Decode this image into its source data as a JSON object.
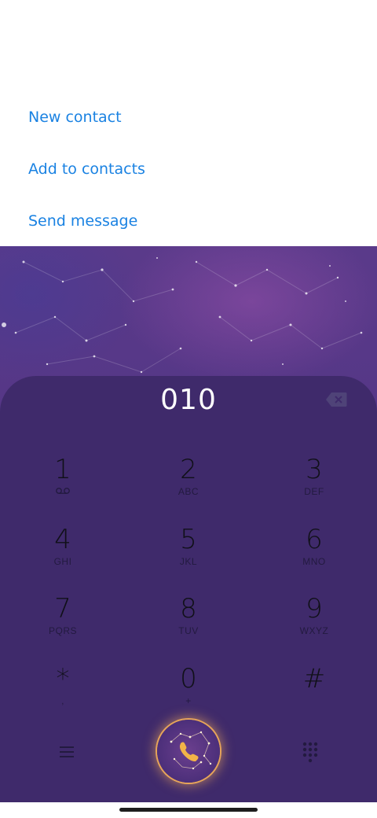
{
  "actions": {
    "new_contact": "New contact",
    "add_to_contacts": "Add to contacts",
    "send_message": "Send message"
  },
  "dialer": {
    "number": "010",
    "keys": [
      {
        "digit": "1",
        "letters": "",
        "icon": "voicemail-icon"
      },
      {
        "digit": "2",
        "letters": "ABC"
      },
      {
        "digit": "3",
        "letters": "DEF"
      },
      {
        "digit": "4",
        "letters": "GHI"
      },
      {
        "digit": "5",
        "letters": "JKL"
      },
      {
        "digit": "6",
        "letters": "MNO"
      },
      {
        "digit": "7",
        "letters": "PQRS"
      },
      {
        "digit": "8",
        "letters": "TUV"
      },
      {
        "digit": "9",
        "letters": "WXYZ"
      },
      {
        "digit": "*",
        "letters": ","
      },
      {
        "digit": "0",
        "letters": "+"
      },
      {
        "digit": "#",
        "letters": ""
      }
    ]
  },
  "icons": {
    "backspace": "backspace-icon",
    "menu": "menu-icon",
    "call": "phone-icon",
    "dialpad": "dialpad-icon"
  },
  "colors": {
    "action_link": "#1a82e2",
    "pad_background": "#3f2a6b",
    "call_ring": "#e6a45a"
  }
}
